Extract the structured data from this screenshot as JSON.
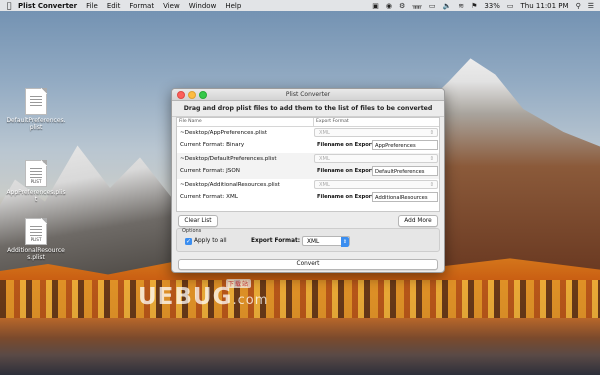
{
  "menubar": {
    "apple": "",
    "items": [
      "Plist Converter",
      "File",
      "Edit",
      "Format",
      "View",
      "Window",
      "Help"
    ],
    "battery": "33%",
    "clock": "Thu 11:01 PM"
  },
  "desktop": {
    "icons": [
      {
        "tag": "",
        "label": "DefaultPreferences.plist"
      },
      {
        "tag": "PLIST",
        "label": "AppPreferences.plist"
      },
      {
        "tag": "PLIST",
        "label": "AdditionalResources.plist"
      }
    ]
  },
  "window": {
    "title": "Plist Converter",
    "instruction": "Drag and drop plist files to add them to the list of files to be converted",
    "columns": {
      "name": "File Name",
      "format": "Export Format"
    },
    "files": [
      {
        "path": "~Desktop/AppPreferences.plist",
        "current_format": "Current Format: Binary",
        "export_format": "XML",
        "filename_label": "Filename on Export",
        "filename": "AppPreferences"
      },
      {
        "path": "~Desktop/DefaultPreferences.plist",
        "current_format": "Current Format: JSON",
        "export_format": "XML",
        "filename_label": "Filename on Export",
        "filename": "DefaultPreferences"
      },
      {
        "path": "~Desktop/AdditionalResources.plist",
        "current_format": "Current Format: XML",
        "export_format": "XML",
        "filename_label": "Filename on Export",
        "filename": "AdditionalResources"
      }
    ],
    "clear_button": "Clear List",
    "add_button": "Add More",
    "options": {
      "title": "Options",
      "apply_to_all": "Apply to all",
      "apply_checked": true,
      "export_format_label": "Export Format:",
      "export_format_value": "XML"
    },
    "convert_button": "Convert"
  },
  "watermark": {
    "brand": "UEBUG",
    "domain": ".com",
    "tag": "下载站"
  },
  "colors": {
    "accent": "#3b8ef0",
    "close": "#fc605c",
    "minimize": "#fdbc40",
    "zoom": "#34c84a"
  }
}
